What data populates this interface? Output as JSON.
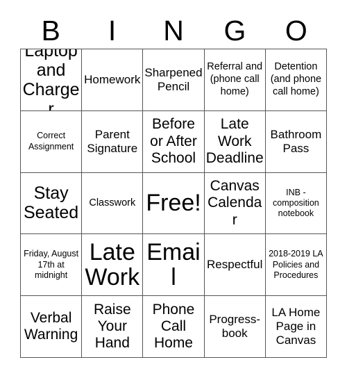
{
  "header": {
    "letters": [
      "B",
      "I",
      "N",
      "G",
      "O"
    ]
  },
  "grid": {
    "rows": 5,
    "columns": 5,
    "border_color": "#555555",
    "background_color": "#ffffff",
    "text_color": "#000000",
    "cells": [
      {
        "text": "Laptop and Charger",
        "size": "xl"
      },
      {
        "text": "Homework",
        "size": "m"
      },
      {
        "text": "Sharpened Pencil",
        "size": "m"
      },
      {
        "text": "Referral and (phone call home)",
        "size": "s"
      },
      {
        "text": "Detention (and phone call home)",
        "size": "s"
      },
      {
        "text": "Correct Assignment",
        "size": "xs"
      },
      {
        "text": "Parent Signature",
        "size": "m"
      },
      {
        "text": "Before or After School",
        "size": "l"
      },
      {
        "text": "Late Work Deadline",
        "size": "l"
      },
      {
        "text": "Bathroom Pass",
        "size": "m"
      },
      {
        "text": "Stay Seated",
        "size": "xl"
      },
      {
        "text": "Classwork",
        "size": "s"
      },
      {
        "text": "Free!",
        "size": "xxl"
      },
      {
        "text": "Canvas Calendar",
        "size": "l"
      },
      {
        "text": "INB - composition notebook",
        "size": "xs"
      },
      {
        "text": "Friday, August 17th at midnight",
        "size": "xs"
      },
      {
        "text": "Late Work",
        "size": "xxl"
      },
      {
        "text": "Email",
        "size": "xxl"
      },
      {
        "text": "Respectful",
        "size": "m"
      },
      {
        "text": "2018-2019 LA Policies and Procedures",
        "size": "xs"
      },
      {
        "text": "Verbal Warning",
        "size": "l"
      },
      {
        "text": "Raise Your Hand",
        "size": "l"
      },
      {
        "text": "Phone Call Home",
        "size": "l"
      },
      {
        "text": "Progress-book",
        "size": "m"
      },
      {
        "text": "LA Home Page in Canvas",
        "size": "m"
      }
    ]
  }
}
